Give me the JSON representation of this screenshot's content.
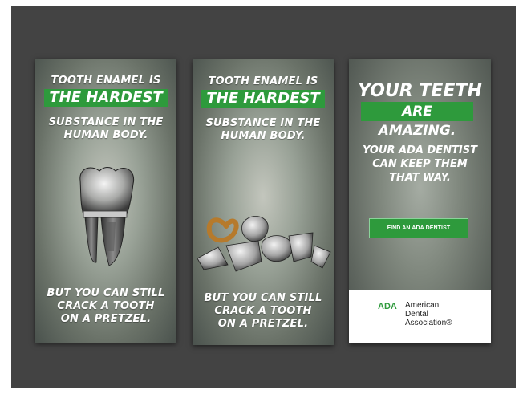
{
  "colors": {
    "accent_green": "#2e9a3c",
    "background": "#434343"
  },
  "panel1": {
    "headline_top": "TOOTH ENAMEL IS",
    "headline_highlight": "THE HARDEST",
    "sub_line1": "SUBSTANCE IN THE",
    "sub_line2": "HUMAN BODY.",
    "foot_line1": "BUT YOU CAN STILL",
    "foot_line2": "CRACK A TOOTH",
    "foot_line3": "ON A PRETZEL.",
    "image_icon": "whole-tooth-icon"
  },
  "panel2": {
    "headline_top": "TOOTH ENAMEL IS",
    "headline_highlight": "THE HARDEST",
    "sub_line1": "SUBSTANCE IN THE",
    "sub_line2": "HUMAN BODY.",
    "foot_line1": "BUT YOU CAN STILL",
    "foot_line2": "CRACK A TOOTH",
    "foot_line3": "ON A PRETZEL.",
    "image_icon": "cracked-tooth-with-pretzel-icon"
  },
  "panel3": {
    "headline_line1": "YOUR TEETH",
    "headline_highlight": "ARE AMAZING.",
    "pitch_line1": "YOUR ADA DENTIST",
    "pitch_line2": "CAN KEEP THEM",
    "pitch_line3": "THAT WAY.",
    "cta_label": "FIND AN ADA DENTIST",
    "logo_abbr": "ADA",
    "logo_name_line1": "American",
    "logo_name_line2": "Dental",
    "logo_name_line3": "Association®"
  }
}
